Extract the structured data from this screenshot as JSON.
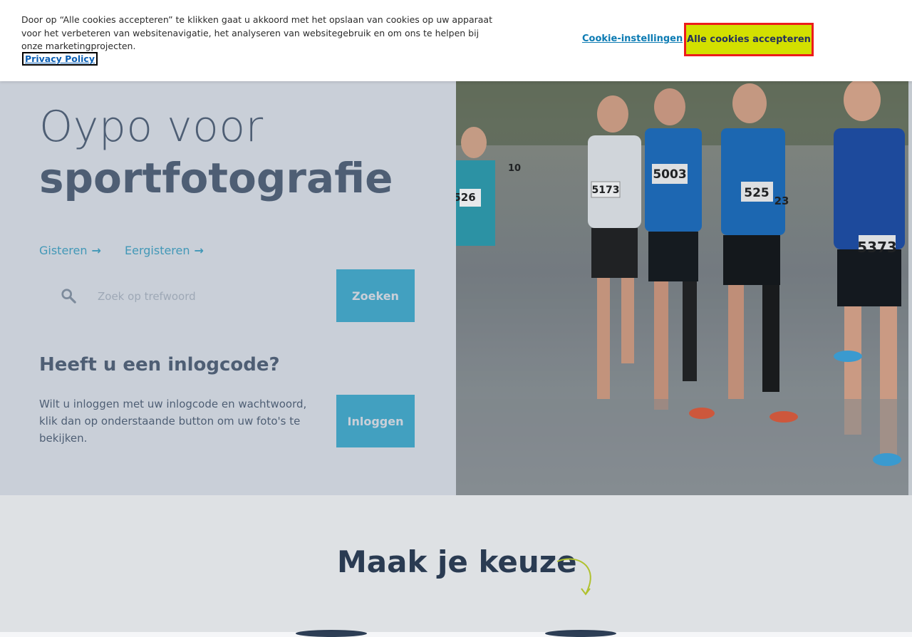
{
  "cookie_banner": {
    "text": "Door op “Alle cookies accepteren” te klikken gaat u akkoord met het opslaan van cookies op uw apparaat voor het verbeteren van websitenavigatie, het analyseren van websitegebruik en om ons te helpen bij onze marketingprojecten.",
    "privacy_link": "Privacy Policy",
    "settings_label": "Cookie-instellingen",
    "accept_label": "Alle cookies accepteren",
    "accept_color": "#d3e000"
  },
  "hero": {
    "title_light": "Oypo voor",
    "title_bold": "sportfotografie",
    "quick_links": [
      {
        "label": "Gisteren",
        "icon": "arrow-right-icon"
      },
      {
        "label": "Eergisteren",
        "icon": "arrow-right-icon"
      }
    ],
    "search": {
      "placeholder": "Zoek op trefwoord",
      "value": "",
      "button_label": "Zoeken",
      "icon": "search-icon"
    },
    "login": {
      "heading": "Heeft u een inlogcode?",
      "text": "Wilt u inloggen met uw inlogcode en wachtwoord, klik dan op onderstaande button om uw foto's te bekijken.",
      "button_label": "Inloggen"
    },
    "photo": {
      "bibs": [
        "5003",
        "525",
        "5373",
        "526",
        "5173",
        "23",
        "10"
      ]
    }
  },
  "section": {
    "title": "Maak je keuze",
    "icon": "curly-arrow-icon"
  },
  "colors": {
    "primary_text": "#2d3e55",
    "accent_teal": "#1aaed8",
    "accent_lime": "#c2d32d"
  }
}
